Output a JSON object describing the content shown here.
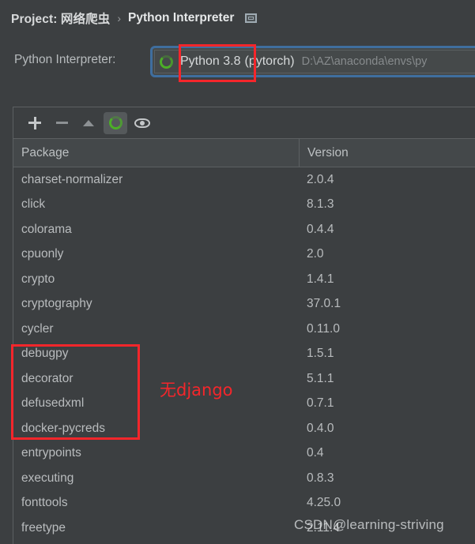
{
  "breadcrumb": {
    "project_label": "Project: 网络爬虫",
    "separator": "›",
    "current": "Python Interpreter",
    "window_icon": "window-icon"
  },
  "interpreter": {
    "label": "Python Interpreter:",
    "status_icon": "loading-spinner-icon",
    "name": "Python 3.8",
    "env": "(pytorch)",
    "path": "D:\\AZ\\anaconda\\envs\\py",
    "focus_ring_color": "#3f6e9e"
  },
  "toolbar": {
    "add": "+",
    "add_icon": "plus-icon",
    "remove_icon": "minus-icon",
    "upgrade_icon": "triangle-up-icon",
    "loading_icon": "loading-spinner-icon",
    "show_early_releases_icon": "eye-icon"
  },
  "table": {
    "headers": {
      "package": "Package",
      "version": "Version"
    },
    "rows": [
      {
        "package": "charset-normalizer",
        "version": "2.0.4"
      },
      {
        "package": "click",
        "version": "8.1.3"
      },
      {
        "package": "colorama",
        "version": "0.4.4"
      },
      {
        "package": "cpuonly",
        "version": "2.0"
      },
      {
        "package": "crypto",
        "version": "1.4.1"
      },
      {
        "package": "cryptography",
        "version": "37.0.1"
      },
      {
        "package": "cycler",
        "version": "0.11.0"
      },
      {
        "package": "debugpy",
        "version": "1.5.1"
      },
      {
        "package": "decorator",
        "version": "5.1.1"
      },
      {
        "package": "defusedxml",
        "version": "0.7.1"
      },
      {
        "package": "docker-pycreds",
        "version": "0.4.0"
      },
      {
        "package": "entrypoints",
        "version": "0.4"
      },
      {
        "package": "executing",
        "version": "0.8.3"
      },
      {
        "package": "fonttools",
        "version": "4.25.0"
      },
      {
        "package": "freetype",
        "version": "2.11.4"
      }
    ]
  },
  "annotations": {
    "color": "#f5262b",
    "no_django_text": "无django"
  },
  "watermark": {
    "text": "CSDN@learning-striving"
  }
}
